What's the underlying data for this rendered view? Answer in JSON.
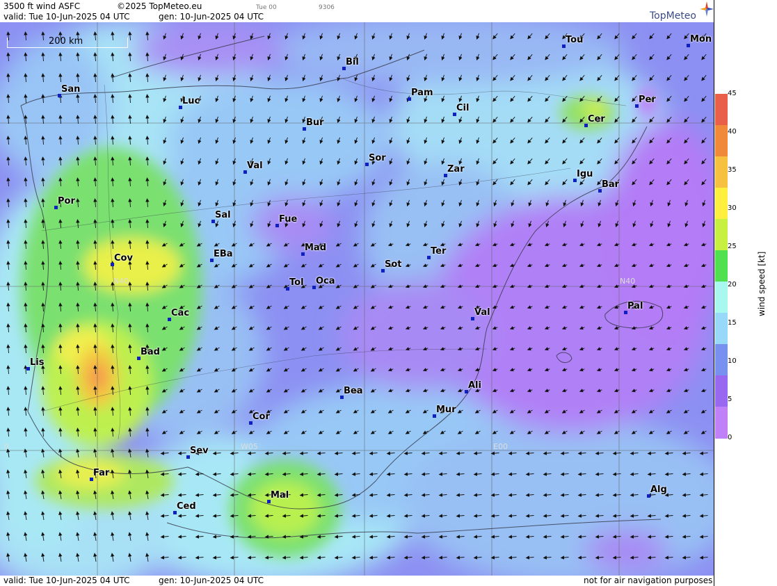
{
  "header": {
    "title": "3500 ft wind ASFC",
    "copyright": "©2025 TopMeteo.eu",
    "run_label": "Tue 00",
    "code": "9306",
    "valid": "valid:  Tue  10-Jun-2025  04 UTC",
    "gen": "gen: 10-Jun-2025 04 UTC"
  },
  "logo": {
    "text": "TopMeteo"
  },
  "scale": {
    "label": "200 km"
  },
  "footer": {
    "valid": "valid:  Tue  10-Jun-2025  04 UTC",
    "gen": "gen: 10-Jun-2025 04 UTC",
    "disclaimer": "not for air navigation purposes"
  },
  "colorbar": {
    "label": "wind speed [kt]",
    "ticks": [
      "45",
      "40",
      "35",
      "30",
      "25",
      "20",
      "15",
      "10",
      "5",
      "0"
    ],
    "colors": [
      "#e8604a",
      "#f08a3a",
      "#f6c040",
      "#fff040",
      "#c8f040",
      "#50e050",
      "#a8f8f0",
      "#98d8f8",
      "#7890f0",
      "#9868f0",
      "#c080f8"
    ]
  },
  "grid_labels": {
    "n40_left": "N40",
    "n40_right": "N40",
    "w05": "W05",
    "e00": "E00",
    "w10": "0"
  },
  "cities": [
    {
      "name": "San"
    },
    {
      "name": "Luc"
    },
    {
      "name": "Bil"
    },
    {
      "name": "Pam"
    },
    {
      "name": "Tou"
    },
    {
      "name": "Mon"
    },
    {
      "name": "Per"
    },
    {
      "name": "Cil"
    },
    {
      "name": "Cer"
    },
    {
      "name": "Bur"
    },
    {
      "name": "Sor"
    },
    {
      "name": "Zar"
    },
    {
      "name": "Igu"
    },
    {
      "name": "Bar"
    },
    {
      "name": "Val"
    },
    {
      "name": "Por"
    },
    {
      "name": "Sal"
    },
    {
      "name": "Fue"
    },
    {
      "name": "Mad"
    },
    {
      "name": "Ter"
    },
    {
      "name": "Cov"
    },
    {
      "name": "EBa"
    },
    {
      "name": "Sot"
    },
    {
      "name": "Tol"
    },
    {
      "name": "Oca"
    },
    {
      "name": "Pal"
    },
    {
      "name": "Val"
    },
    {
      "name": "Cac"
    },
    {
      "name": "Bad"
    },
    {
      "name": "Lis"
    },
    {
      "name": "Ali"
    },
    {
      "name": "Bea"
    },
    {
      "name": "Mur"
    },
    {
      "name": "Cor"
    },
    {
      "name": "Sev"
    },
    {
      "name": "Far"
    },
    {
      "name": "Mal"
    },
    {
      "name": "Ced"
    },
    {
      "name": "Alg"
    }
  ]
}
